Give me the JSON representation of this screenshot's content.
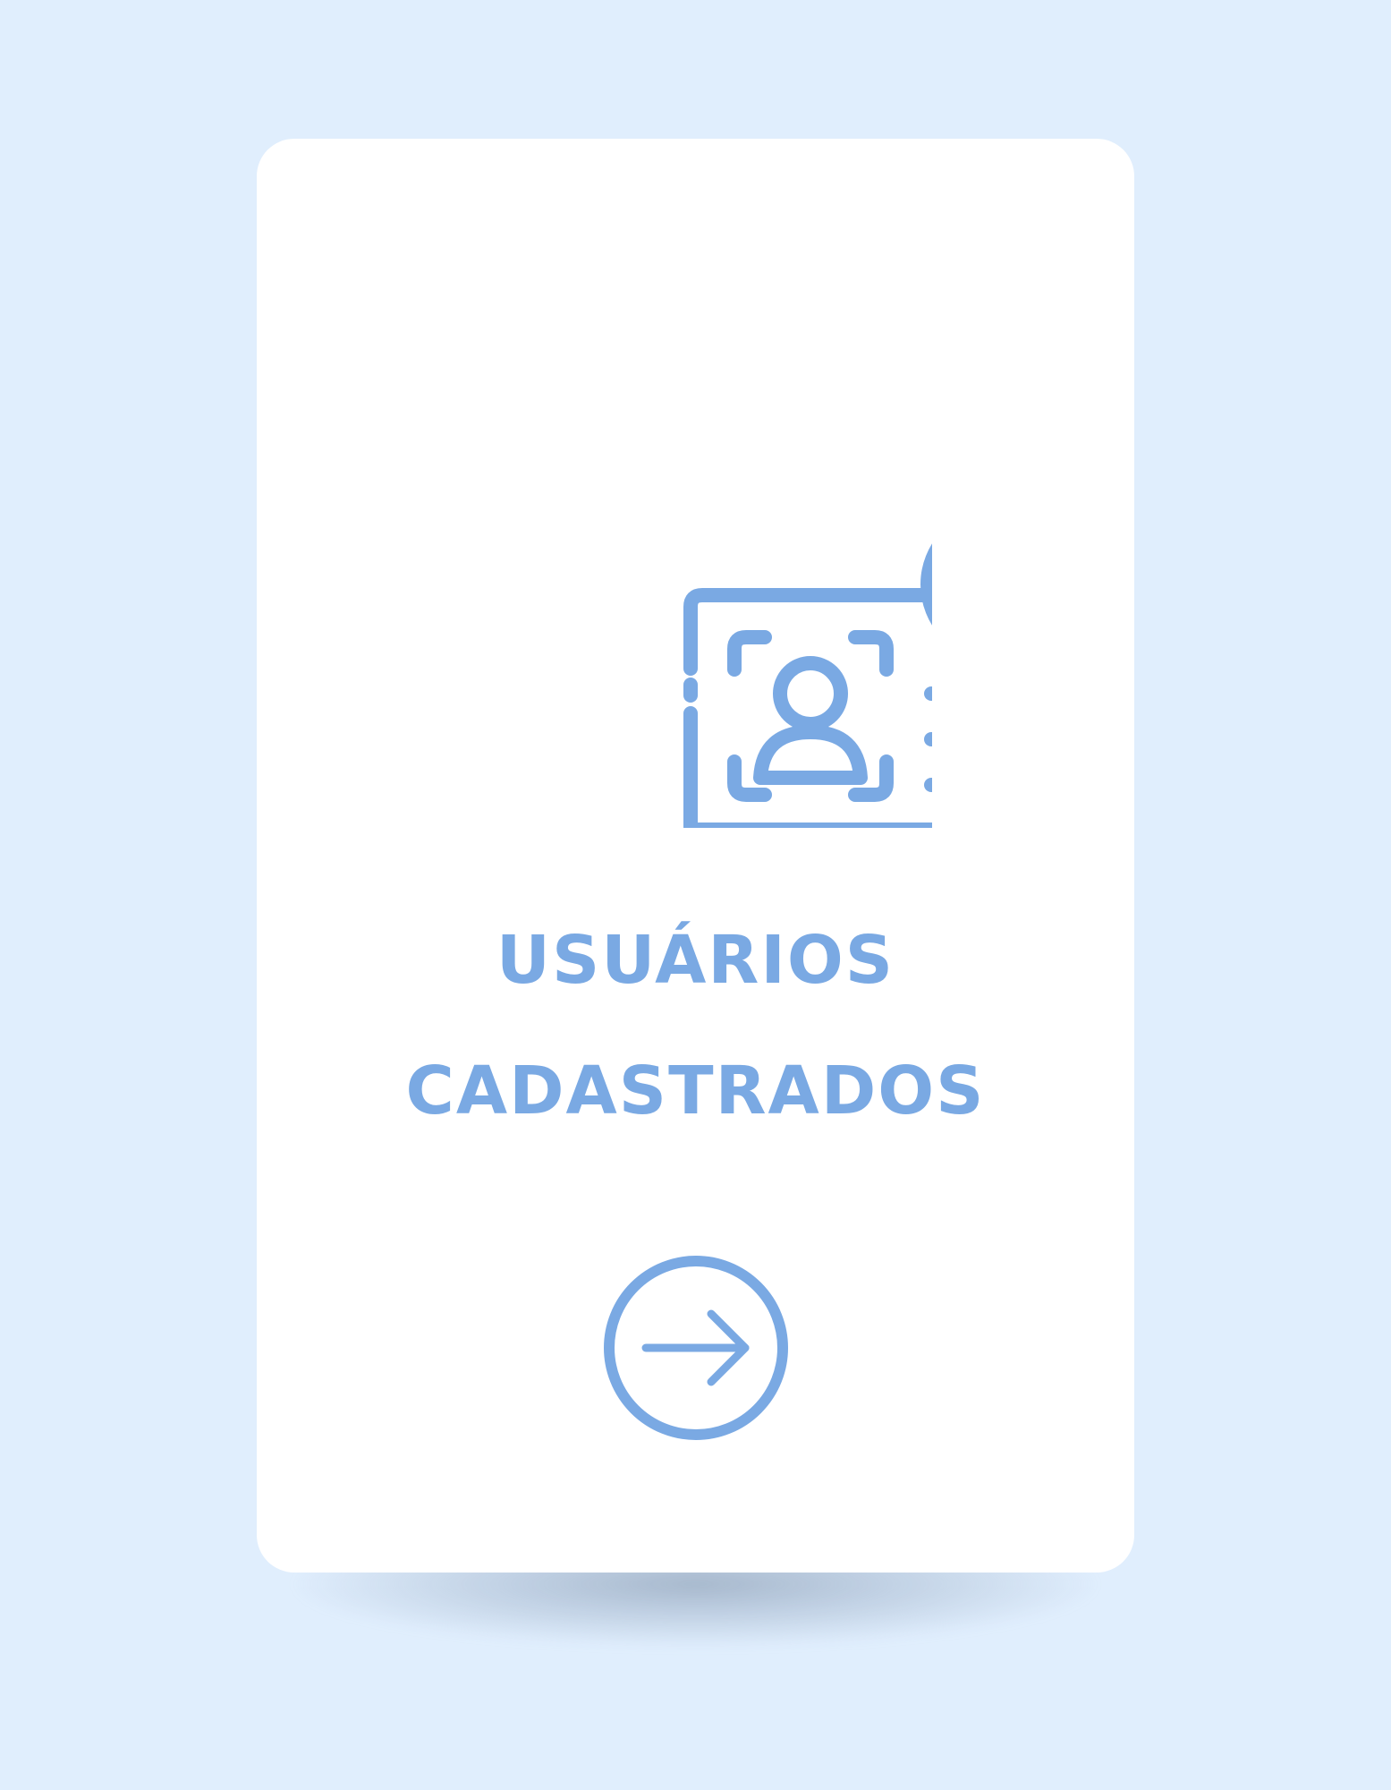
{
  "title": {
    "line1": "USUÁRIOS",
    "line2": "CADASTRADOS"
  },
  "icons": {
    "illustration": "monitor-user-profile-verified-icon",
    "action": "arrow-right-circle-icon"
  },
  "colors": {
    "background": "#e0eefd",
    "card": "#ffffff",
    "accent": "#7aa9e3"
  }
}
